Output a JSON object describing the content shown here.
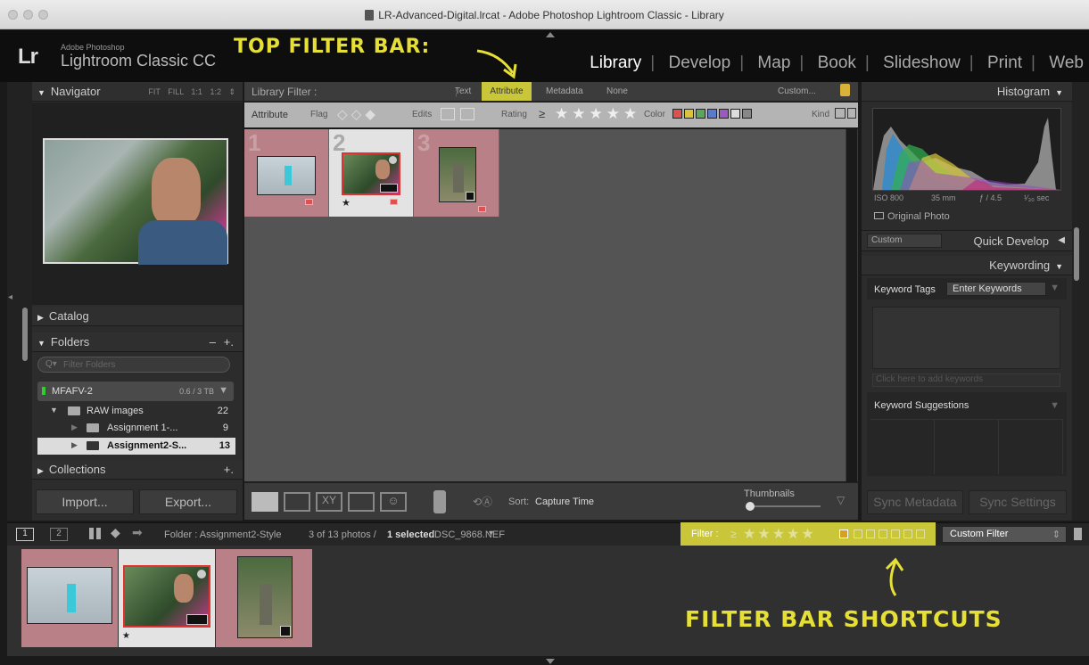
{
  "window": {
    "title": "LR-Advanced-Digital.lrcat - Adobe Photoshop Lightroom Classic - Library"
  },
  "identity": {
    "logo": "Lr",
    "brand_top": "Adobe Photoshop",
    "brand_main": "Lightroom Classic CC"
  },
  "modules": [
    "Library",
    "Develop",
    "Map",
    "Book",
    "Slideshow",
    "Print",
    "Web"
  ],
  "callouts": {
    "top": "TOP FILTER BAR:",
    "bottom": "FILTER BAR SHORTCUTS"
  },
  "navigator": {
    "title": "Navigator",
    "zoom_options": [
      "FIT",
      "FILL",
      "1:1",
      "1:2"
    ]
  },
  "left_panels": {
    "catalog": "Catalog",
    "folders": "Folders",
    "folders_minus": "–",
    "folders_plus": "+.",
    "filter_placeholder": "Filter Folders",
    "volume": {
      "name": "MFAFV-2",
      "usage": "0.6 / 3 TB"
    },
    "folder_rows": [
      {
        "name": "RAW images",
        "count": "22"
      },
      {
        "name": "Assignment 1-...",
        "count": "9"
      },
      {
        "name": "Assignment2-S...",
        "count": "13"
      }
    ],
    "collections": "Collections",
    "collections_plus": "+.",
    "import_label": "Import...",
    "export_label": "Export..."
  },
  "library_filter": {
    "label": "Library Filter :",
    "tabs": [
      "Text",
      "Attribute",
      "Metadata",
      "None"
    ],
    "active_tab": "Attribute",
    "preset": "Custom...",
    "attribute_row": {
      "attribute": "Attribute",
      "flag": "Flag",
      "edits": "Edits",
      "rating": "Rating",
      "rating_op": "≥",
      "color": "Color",
      "kind": "Kind"
    },
    "color_swatches": [
      "#e05050",
      "#d9c33a",
      "#59a85a",
      "#5a7ad0",
      "#9a5ac0",
      "#cccccc",
      "#888888"
    ]
  },
  "grid": {
    "cells": [
      {
        "number": "1",
        "selected": false
      },
      {
        "number": "2",
        "selected": true
      },
      {
        "number": "3",
        "selected": false
      }
    ]
  },
  "toolbar": {
    "sort_label": "Sort:",
    "sort_value": "Capture Time",
    "thumbnails_label": "Thumbnails"
  },
  "histogram": {
    "title": "Histogram",
    "iso": "ISO 800",
    "focal": "35 mm",
    "aperture": "ƒ / 4.5",
    "shutter": "¹⁄₃₀ sec",
    "original_photo": "Original Photo"
  },
  "quick_develop": {
    "preset": "Custom",
    "title": "Quick Develop"
  },
  "keywording": {
    "title": "Keywording",
    "tags_label": "Keyword Tags",
    "tags_dropdown": "Enter Keywords",
    "add_placeholder": "Click here to add keywords",
    "suggestions": "Keyword Suggestions"
  },
  "sync": {
    "metadata": "Sync Metadata",
    "settings": "Sync Settings"
  },
  "filmstrip": {
    "view1": "1",
    "view2": "2",
    "source": "Folder : Assignment2-Style",
    "count": "3 of 13 photos /",
    "selected": "1 selected",
    "filename": "/DSC_9868.NEF",
    "filter_label": "Filter :",
    "filter_op": "≥",
    "custom_filter": "Custom Filter"
  }
}
